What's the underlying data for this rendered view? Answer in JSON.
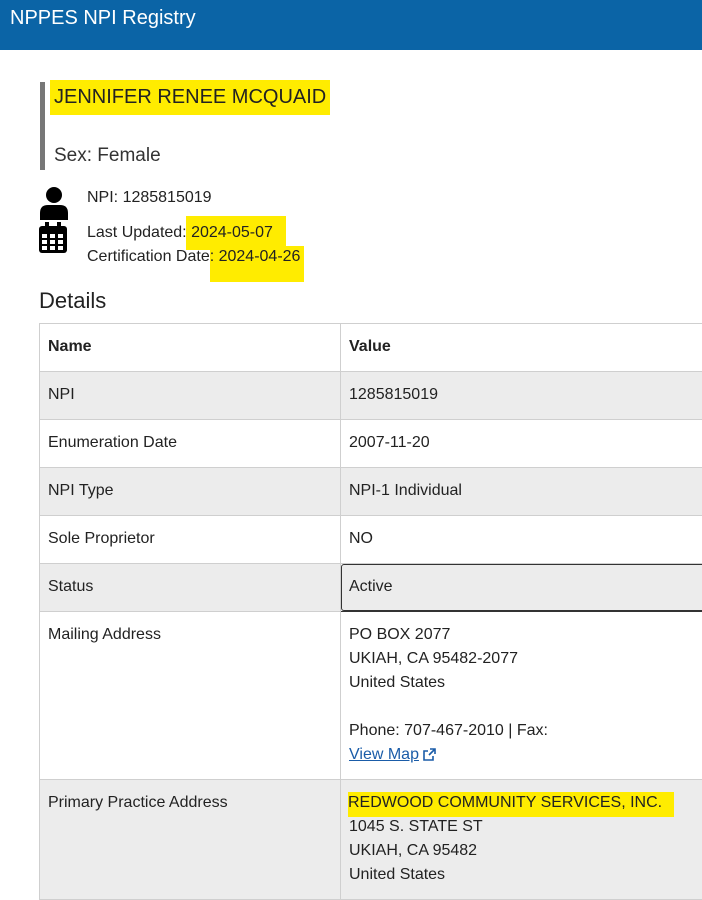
{
  "header": {
    "title": "NPPES NPI Registry"
  },
  "provider": {
    "name": "JENNIFER RENEE MCQUAID",
    "sex": "Sex: Female",
    "npi_label": "NPI: ",
    "npi": "1285815019",
    "last_updated_label": "Last Updated: ",
    "last_updated": "2024-05-07",
    "cert_label": "Certification Date: ",
    "cert_date": "2024-04-26"
  },
  "details": {
    "title": "Details",
    "columns": [
      "Name",
      "Value"
    ],
    "rows": [
      {
        "name": "NPI",
        "value": "1285815019"
      },
      {
        "name": "Enumeration Date",
        "value": "2007-11-20"
      },
      {
        "name": "NPI Type",
        "value": "NPI-1 Individual"
      },
      {
        "name": "Sole Proprietor",
        "value": "NO"
      },
      {
        "name": "Status",
        "value": "Active"
      }
    ],
    "mailing": {
      "name": "Mailing Address",
      "line1": "PO BOX 2077",
      "line2": "UKIAH, CA 95482-2077",
      "line3": "United States",
      "phone": "Phone: 707-467-2010 | Fax:",
      "map_link": "View Map"
    },
    "practice": {
      "name": "Primary Practice Address",
      "org": "REDWOOD COMMUNITY SERVICES, INC.",
      "line1": "1045 S. STATE ST",
      "line2": "UKIAH, CA 95482",
      "line3": "United States"
    }
  },
  "icons": [
    "person-icon",
    "calendar-icon",
    "external-link-icon"
  ],
  "colors": {
    "header_bg": "#0b64a6",
    "highlight": "#ffec00",
    "link": "#1a5ca8"
  }
}
